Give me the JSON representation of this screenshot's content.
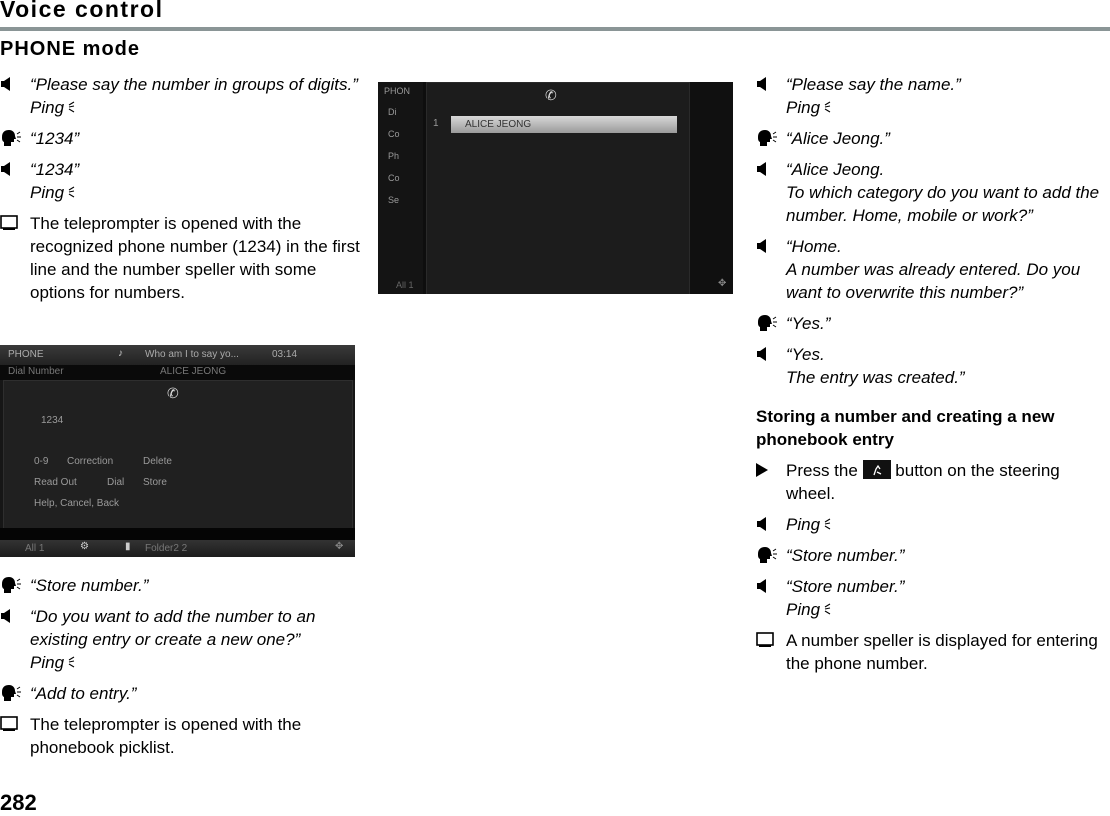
{
  "header": {
    "chapter_title": "Voice control",
    "section_title": "PHONE mode"
  },
  "column1": {
    "steps_before": [
      {
        "icon": "speaker-icon",
        "lines": [
          "“Please say the number in groups of digits.”"
        ],
        "ping": "Ping"
      },
      {
        "icon": "speaking-head-icon",
        "lines": [
          "“1234”"
        ]
      },
      {
        "icon": "speaker-icon",
        "lines": [
          "“1234”"
        ],
        "ping": "Ping"
      },
      {
        "icon": "display-icon",
        "lines": [
          "The teleprompter is opened with the recognized phone number (1234) in the first line and the number speller with some options for numbers."
        ]
      }
    ],
    "steps_after": [
      {
        "icon": "speaking-head-icon",
        "lines": [
          "“Store number.”"
        ]
      },
      {
        "icon": "speaker-icon",
        "lines": [
          "“Do you want to add the number to an existing entry or create a new one?”"
        ],
        "ping": "Ping"
      },
      {
        "icon": "speaking-head-icon",
        "lines": [
          "“Add to entry.”"
        ]
      },
      {
        "icon": "display-icon",
        "lines": [
          "The teleprompter is opened with the phonebook picklist."
        ]
      }
    ]
  },
  "screen1": {
    "top_title": "PHONE",
    "top_message": "Who am I to say yo...",
    "top_time": "03:14",
    "row_label": "Dial Number",
    "row_value": "ALICE JEONG",
    "number": "1234",
    "options": [
      "0-9",
      "Correction",
      "Delete",
      "Read Out",
      "Dial",
      "Store",
      "Help, Cancel, Back"
    ],
    "bottom_left": "All 1",
    "bottom_folder": "Folder2 2"
  },
  "screen2": {
    "side_title": "PHON",
    "side_items": [
      "Di",
      "Co",
      "Ph",
      "Co",
      "Se"
    ],
    "list_index": "1",
    "list_item": "ALICE JEONG",
    "bottom_left": "All 1"
  },
  "column3": {
    "steps_before": [
      {
        "icon": "speaker-icon",
        "lines": [
          "“Please say the name.”"
        ],
        "ping": "Ping"
      },
      {
        "icon": "speaking-head-icon",
        "lines": [
          "“Alice Jeong.”"
        ]
      },
      {
        "icon": "speaker-icon",
        "lines": [
          "“Alice Jeong.",
          "To which category do you want to add the number. Home, mobile or work?”"
        ]
      },
      {
        "icon": "speaker-icon",
        "lines": [
          "“Home.",
          "A number was already entered. Do you want to overwrite this number?”"
        ]
      },
      {
        "icon": "speaking-head-icon",
        "lines": [
          "“Yes.”"
        ]
      },
      {
        "icon": "speaker-icon",
        "lines": [
          "“Yes.",
          "The entry was created.”"
        ]
      }
    ],
    "heading": "Storing a number and creating a new phonebook entry",
    "press_prefix": "Press the",
    "press_suffix": "button on the steering wheel.",
    "steps_after": [
      {
        "icon": "speaker-icon",
        "lines": [],
        "ping": "Ping"
      },
      {
        "icon": "speaking-head-icon",
        "lines": [
          "“Store number.”"
        ]
      },
      {
        "icon": "speaker-icon",
        "lines": [
          "“Store number.”"
        ],
        "ping": "Ping"
      },
      {
        "icon": "display-icon",
        "lines": [
          "A number speller is displayed for entering the phone number."
        ]
      }
    ]
  },
  "footer": {
    "page_number": "282"
  }
}
